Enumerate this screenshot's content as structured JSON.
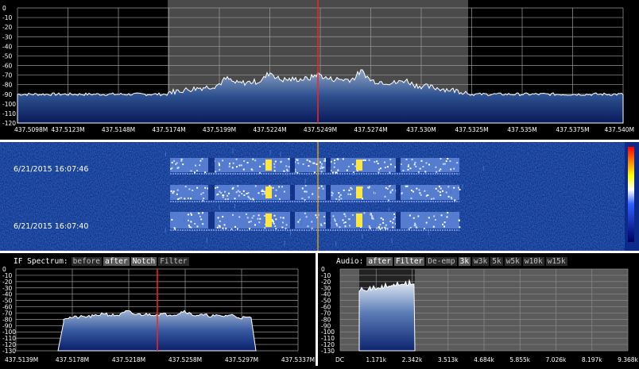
{
  "main_spectrum": {
    "y_labels": [
      "0",
      "-10",
      "-20",
      "-30",
      "-40",
      "-50",
      "-60",
      "-70",
      "-80",
      "-90",
      "-100",
      "-110",
      "-120"
    ],
    "x_labels": [
      "437.5098M",
      "437.5123M",
      "437.5148M",
      "437.5174M",
      "437.5199M",
      "437.5224M",
      "437.5249M",
      "437.5274M",
      "437.530M",
      "437.5325M",
      "437.535M",
      "437.5375M",
      "437.540M"
    ],
    "center_color": "#ff2020"
  },
  "waterfall": {
    "timestamps": [
      "6/21/2015 16:07:46",
      "6/21/2015 16:07:40"
    ]
  },
  "if_spectrum": {
    "title": "IF Spectrum:",
    "buttons": [
      {
        "label": "before",
        "active": false
      },
      {
        "label": "after",
        "active": true
      },
      {
        "label": "Notch",
        "active": true
      },
      {
        "label": "Filter",
        "active": false
      }
    ],
    "y_labels": [
      "0",
      "-10",
      "-20",
      "-30",
      "-40",
      "-50",
      "-60",
      "-70",
      "-80",
      "-90",
      "-100",
      "-110",
      "-120",
      "-130"
    ],
    "x_labels": [
      "437.5139M",
      "437.5178M",
      "437.5218M",
      "437.5258M",
      "437.5297M",
      "437.5337M"
    ]
  },
  "audio": {
    "title": "Audio:",
    "buttons": [
      {
        "label": "after",
        "active": true
      },
      {
        "label": "Filter",
        "active": true
      },
      {
        "label": "De-emp",
        "active": false
      },
      {
        "label": "3k",
        "active": true
      },
      {
        "label": "w3k",
        "active": false
      },
      {
        "label": "5k",
        "active": false
      },
      {
        "label": "w5k",
        "active": false
      },
      {
        "label": "w10k",
        "active": false
      },
      {
        "label": "w15k",
        "active": false
      }
    ],
    "y_labels": [
      "0",
      "-10",
      "-20",
      "-30",
      "-40",
      "-50",
      "-60",
      "-70",
      "-80",
      "-90",
      "-100",
      "-110",
      "-120",
      "-130"
    ],
    "x_labels": [
      "DC",
      "1.171k",
      "2.342k",
      "3.513k",
      "4.684k",
      "5.855k",
      "7.026k",
      "8.197k",
      "9.368k"
    ]
  }
}
